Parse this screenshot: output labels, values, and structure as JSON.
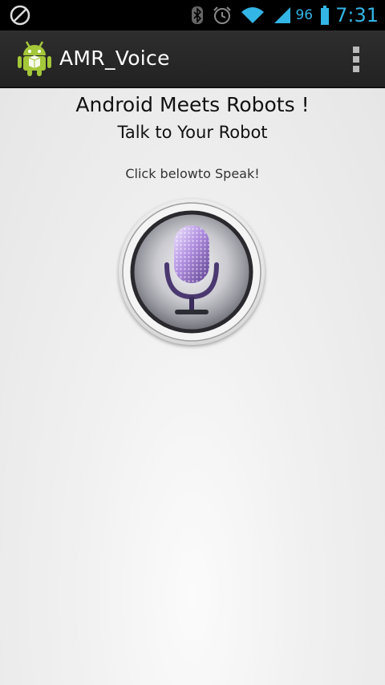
{
  "status_bar": {
    "battery_percent": "96",
    "time": "7:31",
    "icons": [
      "blocked-icon",
      "bluetooth-icon",
      "alarm-icon",
      "wifi-icon",
      "signal-icon",
      "battery-icon"
    ]
  },
  "action_bar": {
    "title": "AMR_Voice",
    "icon": "android-app-icon",
    "menu_icon": "overflow-menu-icon"
  },
  "main": {
    "heading": "Android Meets Robots !",
    "subheading": "Talk to Your Robot",
    "instruction": "Click belowto Speak!",
    "mic_icon": "microphone-icon"
  },
  "colors": {
    "status_accent": "#33b5e5",
    "action_bar_bg": "#2a2a2a",
    "mic_accent": "#8a5cc8"
  }
}
